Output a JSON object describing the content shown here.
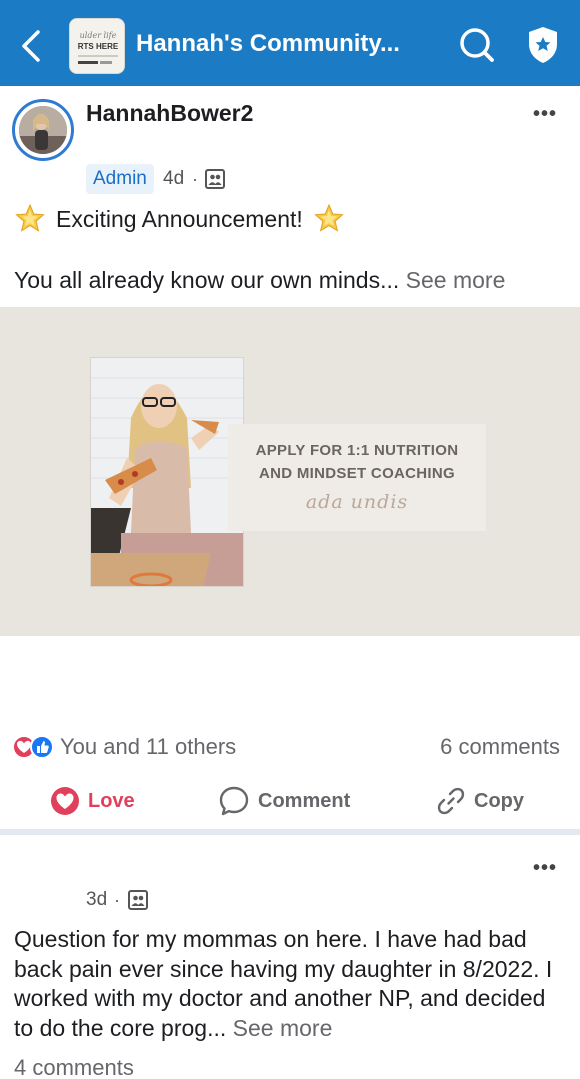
{
  "header": {
    "title": "Hannah's Community...",
    "icons": [
      "back-icon",
      "group-thumbnail",
      "search-icon",
      "shield-star-icon"
    ],
    "thumbnail_text": [
      "ulder life",
      "RTS HERE"
    ]
  },
  "post1": {
    "author": "HannahBower2",
    "badge": "Admin",
    "time": "4d",
    "dot": "·",
    "headline": "Exciting Announcement!",
    "body": "You all already know our own minds...",
    "see_more": "See more",
    "image": {
      "line1": "APPLY FOR 1:1 NUTRITION",
      "line2": "AND MINDSET COACHING",
      "signature": "ada undis"
    },
    "reactions_text": "You and 11 others",
    "comments": "6 comments",
    "actions": {
      "love": "Love",
      "comment": "Comment",
      "copy": "Copy"
    }
  },
  "post2": {
    "time": "3d",
    "dot": "·",
    "body": "Question for my mommas on here. I have had bad back pain ever since having my daughter in 8/2022. I worked with my doctor and another NP, and decided to do the core prog...",
    "see_more": "See more",
    "comments": "4 comments"
  },
  "colors": {
    "header_bg": "#1b7bc4",
    "love": "#e0405b",
    "like": "#1877f2",
    "admin_bg": "#e9f2fb",
    "admin_text": "#1b6fc2"
  }
}
